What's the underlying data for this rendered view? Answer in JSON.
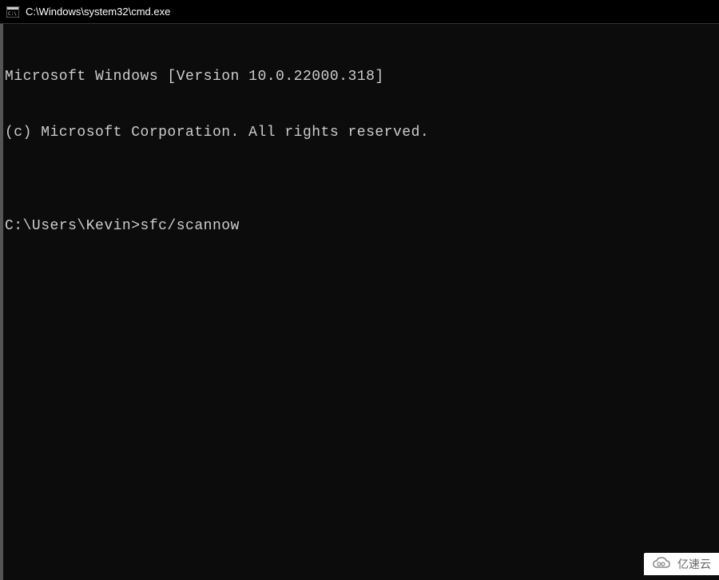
{
  "titlebar": {
    "title": "C:\\Windows\\system32\\cmd.exe"
  },
  "terminal": {
    "line1": "Microsoft Windows [Version 10.0.22000.318]",
    "line2": "(c) Microsoft Corporation. All rights reserved.",
    "blank": "",
    "prompt": "C:\\Users\\Kevin>",
    "command": "sfc/scannow"
  },
  "watermark": {
    "text": "亿速云"
  }
}
